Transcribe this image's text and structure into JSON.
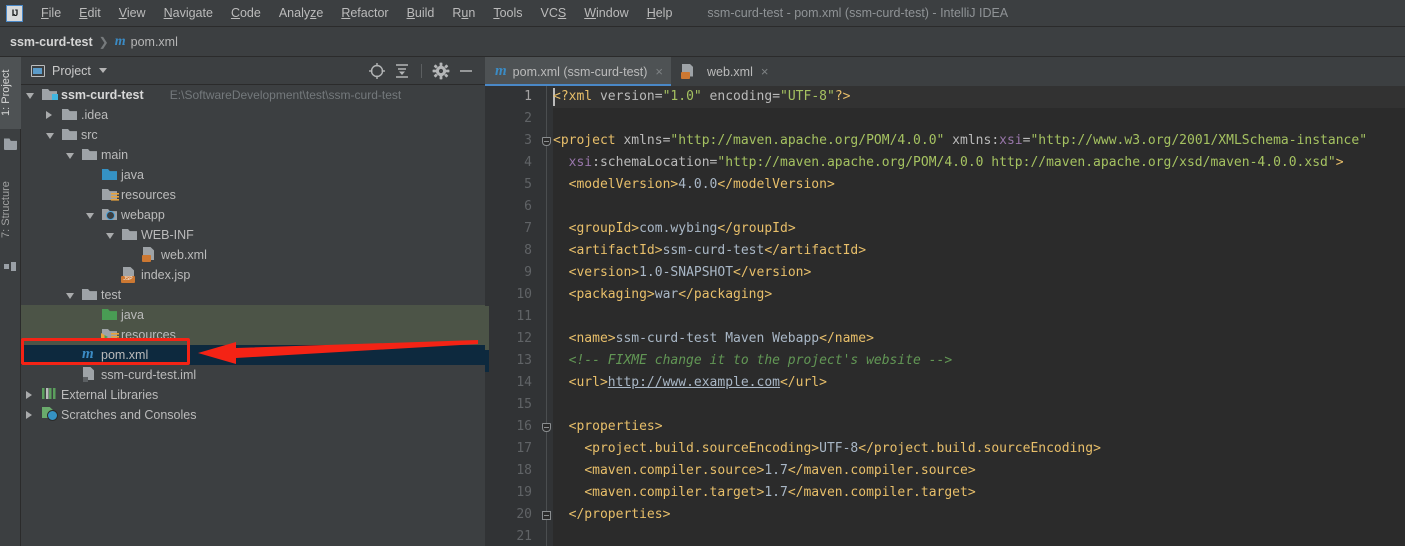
{
  "window": {
    "title": "ssm-curd-test - pom.xml (ssm-curd-test) - IntelliJ IDEA",
    "logo": "IJ"
  },
  "menu": {
    "items": [
      {
        "label": "File",
        "mnemonic": "F"
      },
      {
        "label": "Edit",
        "mnemonic": "E"
      },
      {
        "label": "View",
        "mnemonic": "V"
      },
      {
        "label": "Navigate",
        "mnemonic": "N"
      },
      {
        "label": "Code",
        "mnemonic": "C"
      },
      {
        "label": "Analyze",
        "mnemonic": "z"
      },
      {
        "label": "Refactor",
        "mnemonic": "R"
      },
      {
        "label": "Build",
        "mnemonic": "B"
      },
      {
        "label": "Run",
        "mnemonic": "u"
      },
      {
        "label": "Tools",
        "mnemonic": "T"
      },
      {
        "label": "VCS",
        "mnemonic": "S"
      },
      {
        "label": "Window",
        "mnemonic": "W"
      },
      {
        "label": "Help",
        "mnemonic": "H"
      }
    ]
  },
  "navbar": {
    "project": "ssm-curd-test",
    "separator": "❯",
    "file_icon": "m",
    "file": "pom.xml"
  },
  "toolstrip": {
    "buttons": [
      {
        "label": "1: Project",
        "active": true,
        "icon": "project-icon"
      },
      {
        "label": "7: Structure",
        "active": false,
        "icon": "structure-icon"
      }
    ]
  },
  "project_panel": {
    "title": "Project",
    "actions": [
      {
        "name": "select-opened-file-button",
        "icon": "crosshair-icon"
      },
      {
        "name": "collapse-all-button",
        "icon": "collapse-all-icon"
      },
      {
        "name": "settings-button",
        "icon": "gear-icon"
      },
      {
        "name": "hide-button",
        "icon": "minimize-icon"
      }
    ],
    "tree": [
      {
        "label": "ssm-curd-test",
        "path": "E:\\SoftwareDevelopment\\test\\ssm-curd-test",
        "depth": 0,
        "arrow": "open",
        "icon": "folder-module",
        "bold": true,
        "state": "normal"
      },
      {
        "label": ".idea",
        "path": "",
        "depth": 1,
        "arrow": "closed",
        "icon": "folder-grey",
        "bold": false,
        "state": "normal"
      },
      {
        "label": "src",
        "path": "",
        "depth": 1,
        "arrow": "open",
        "icon": "folder-grey",
        "bold": false,
        "state": "normal"
      },
      {
        "label": "main",
        "path": "",
        "depth": 2,
        "arrow": "open",
        "icon": "folder-grey",
        "bold": false,
        "state": "normal"
      },
      {
        "label": "java",
        "path": "",
        "depth": 3,
        "arrow": "none",
        "icon": "folder-source",
        "bold": false,
        "state": "normal"
      },
      {
        "label": "resources",
        "path": "",
        "depth": 3,
        "arrow": "none",
        "icon": "folder-resource",
        "bold": false,
        "state": "normal"
      },
      {
        "label": "webapp",
        "path": "",
        "depth": 3,
        "arrow": "open",
        "icon": "folder-webapp",
        "bold": false,
        "state": "normal"
      },
      {
        "label": "WEB-INF",
        "path": "",
        "depth": 4,
        "arrow": "open",
        "icon": "folder-grey",
        "bold": false,
        "state": "normal"
      },
      {
        "label": "web.xml",
        "path": "",
        "depth": 5,
        "arrow": "none",
        "icon": "file-xml",
        "bold": false,
        "state": "normal"
      },
      {
        "label": "index.jsp",
        "path": "",
        "depth": 4,
        "arrow": "none",
        "icon": "file-jsp",
        "bold": false,
        "state": "normal"
      },
      {
        "label": "test",
        "path": "",
        "depth": 2,
        "arrow": "open",
        "icon": "folder-grey",
        "bold": false,
        "state": "normal"
      },
      {
        "label": "java",
        "path": "",
        "depth": 3,
        "arrow": "none",
        "icon": "folder-test-source",
        "bold": false,
        "state": "test-src"
      },
      {
        "label": "resources",
        "path": "",
        "depth": 3,
        "arrow": "none",
        "icon": "folder-test-resource",
        "bold": false,
        "state": "test-src"
      },
      {
        "label": "pom.xml",
        "path": "",
        "depth": 2,
        "arrow": "none",
        "icon": "file-maven",
        "bold": false,
        "state": "selected"
      },
      {
        "label": "ssm-curd-test.iml",
        "path": "",
        "depth": 2,
        "arrow": "none",
        "icon": "file-iml",
        "bold": false,
        "state": "normal"
      },
      {
        "label": "External Libraries",
        "path": "",
        "depth": 0,
        "arrow": "closed",
        "icon": "library-icon",
        "bold": false,
        "state": "normal"
      },
      {
        "label": "Scratches and Consoles",
        "path": "",
        "depth": 0,
        "arrow": "closed",
        "icon": "scratch-icon",
        "bold": false,
        "state": "normal"
      }
    ]
  },
  "annotation": {
    "box_color": "#f42315",
    "arrow_color": "#f42315",
    "highlighted_item": "pom.xml"
  },
  "editor": {
    "tabs": [
      {
        "label": "pom.xml (ssm-curd-test)",
        "icon": "maven-icon",
        "active": true,
        "close": "×"
      },
      {
        "label": "web.xml",
        "icon": "xml-icon",
        "active": false,
        "close": "×"
      }
    ],
    "first_line": 1,
    "last_line": 21,
    "cursor_line": 1,
    "line_numbers": [
      1,
      2,
      3,
      4,
      5,
      6,
      7,
      8,
      9,
      10,
      11,
      12,
      13,
      14,
      15,
      16,
      17,
      18,
      19,
      20,
      21
    ],
    "fold_lines": [
      3,
      16,
      20
    ],
    "lines": [
      {
        "n": 1,
        "tokens": [
          {
            "t": "<?xml",
            "c": "tg"
          },
          {
            "t": " version",
            "c": "at"
          },
          {
            "t": "=",
            "c": "eq"
          },
          {
            "t": "\"1.0\"",
            "c": "st"
          },
          {
            "t": " encoding",
            "c": "at"
          },
          {
            "t": "=",
            "c": "eq"
          },
          {
            "t": "\"UTF-8\"",
            "c": "st"
          },
          {
            "t": "?>",
            "c": "tg"
          }
        ]
      },
      {
        "n": 2,
        "tokens": []
      },
      {
        "n": 3,
        "tokens": [
          {
            "t": "<project",
            "c": "tg"
          },
          {
            "t": " xmlns",
            "c": "at"
          },
          {
            "t": "=",
            "c": "eq"
          },
          {
            "t": "\"http://maven.apache.org/POM/4.0.0\"",
            "c": "st"
          },
          {
            "t": " xmlns:",
            "c": "at"
          },
          {
            "t": "xsi",
            "c": "ns"
          },
          {
            "t": "=",
            "c": "eq"
          },
          {
            "t": "\"http://www.w3.org/2001/XMLSchema-instance\"",
            "c": "st"
          }
        ]
      },
      {
        "n": 4,
        "indent": 2,
        "tokens": [
          {
            "t": "xsi",
            "c": "ns"
          },
          {
            "t": ":schemaLocation",
            "c": "at"
          },
          {
            "t": "=",
            "c": "eq"
          },
          {
            "t": "\"http://maven.apache.org/POM/4.0.0 http://maven.apache.org/xsd/maven-4.0.0.xsd\"",
            "c": "st"
          },
          {
            "t": ">",
            "c": "tg"
          }
        ]
      },
      {
        "n": 5,
        "indent": 2,
        "tokens": [
          {
            "t": "<modelVersion>",
            "c": "tg"
          },
          {
            "t": "4.0.0",
            "c": "tx"
          },
          {
            "t": "</modelVersion>",
            "c": "tg"
          }
        ]
      },
      {
        "n": 6,
        "tokens": []
      },
      {
        "n": 7,
        "indent": 2,
        "tokens": [
          {
            "t": "<groupId>",
            "c": "tg"
          },
          {
            "t": "com.wybing",
            "c": "tx"
          },
          {
            "t": "</groupId>",
            "c": "tg"
          }
        ]
      },
      {
        "n": 8,
        "indent": 2,
        "tokens": [
          {
            "t": "<artifactId>",
            "c": "tg"
          },
          {
            "t": "ssm-curd-test",
            "c": "tx"
          },
          {
            "t": "</artifactId>",
            "c": "tg"
          }
        ]
      },
      {
        "n": 9,
        "indent": 2,
        "tokens": [
          {
            "t": "<version>",
            "c": "tg"
          },
          {
            "t": "1.0-SNAPSHOT",
            "c": "tx"
          },
          {
            "t": "</version>",
            "c": "tg"
          }
        ]
      },
      {
        "n": 10,
        "indent": 2,
        "tokens": [
          {
            "t": "<packaging>",
            "c": "tg"
          },
          {
            "t": "war",
            "c": "tx"
          },
          {
            "t": "</packaging>",
            "c": "tg"
          }
        ]
      },
      {
        "n": 11,
        "tokens": []
      },
      {
        "n": 12,
        "indent": 2,
        "tokens": [
          {
            "t": "<name>",
            "c": "tg"
          },
          {
            "t": "ssm-curd-test Maven Webapp",
            "c": "tx"
          },
          {
            "t": "</name>",
            "c": "tg"
          }
        ]
      },
      {
        "n": 13,
        "indent": 2,
        "tokens": [
          {
            "t": "<!-- FIXME change it to the project's website -->",
            "c": "cm"
          }
        ]
      },
      {
        "n": 14,
        "indent": 2,
        "tokens": [
          {
            "t": "<url>",
            "c": "tg"
          },
          {
            "t": "http://www.example.com",
            "c": "lnk"
          },
          {
            "t": "</url>",
            "c": "tg"
          }
        ]
      },
      {
        "n": 15,
        "tokens": []
      },
      {
        "n": 16,
        "indent": 2,
        "tokens": [
          {
            "t": "<properties>",
            "c": "tg"
          }
        ]
      },
      {
        "n": 17,
        "indent": 4,
        "tokens": [
          {
            "t": "<project.build.sourceEncoding>",
            "c": "tg"
          },
          {
            "t": "UTF-8",
            "c": "tx"
          },
          {
            "t": "</project.build.sourceEncoding>",
            "c": "tg"
          }
        ]
      },
      {
        "n": 18,
        "indent": 4,
        "tokens": [
          {
            "t": "<maven.compiler.source>",
            "c": "tg"
          },
          {
            "t": "1.7",
            "c": "tx"
          },
          {
            "t": "</maven.compiler.source>",
            "c": "tg"
          }
        ]
      },
      {
        "n": 19,
        "indent": 4,
        "tokens": [
          {
            "t": "<maven.compiler.target>",
            "c": "tg"
          },
          {
            "t": "1.7",
            "c": "tx"
          },
          {
            "t": "</maven.compiler.target>",
            "c": "tg"
          }
        ]
      },
      {
        "n": 20,
        "indent": 2,
        "tokens": [
          {
            "t": "</properties>",
            "c": "tg"
          }
        ]
      },
      {
        "n": 21,
        "tokens": []
      }
    ]
  },
  "colors": {
    "chrome": "#3c3f41",
    "editor_bg": "#2b2b2b",
    "gutter_bg": "#313335",
    "selection": "#0d293e",
    "test_source": "#4c5447",
    "accent": "#4a88c7",
    "annotation_red": "#f42315"
  }
}
